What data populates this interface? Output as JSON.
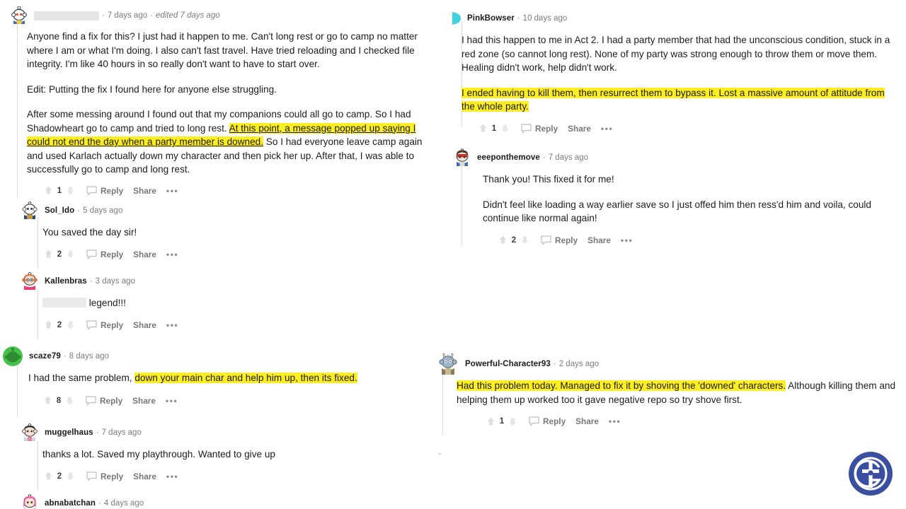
{
  "page": {
    "title": "Reddit comment thread screenshot",
    "watermark_label": "GI logo",
    "watermark_color": "#3b4fa0"
  },
  "highlight_color": "#fcee21",
  "left_column": {
    "comments": [
      {
        "id": "op-comment",
        "username": "",
        "username_redacted": true,
        "timestamp": "7 days ago",
        "edited": "edited 7 days ago",
        "avatar_name": "snoo-avatar-blue",
        "avatar_color": "#4c6ea8",
        "paragraphs": [
          "Anyone find a fix for this? I just had it happen to me. Can't long rest or go to camp no matter where I am or what I'm doing. I also can't fast travel. Have tried reloading and I checked file integrity. I'm like 40 hours in so really don't want to have to start over.",
          "Edit: Putting the fix I found here for anyone else struggling."
        ],
        "body_pre": "After some messing around I found out that my companions could all go to camp. So I had Shadowheart go to camp and tried to long rest. ",
        "body_highlight": "At this point, a message popped up saying I could not end the day when a party member is downed.",
        "body_post": " So I had everyone leave camp again and used Karlach actually down my character and then pick her up. After that, I was able to successfully go to camp and long rest.",
        "score": "1",
        "reply_label": "Reply",
        "share_label": "Share",
        "more_label": "•••"
      },
      {
        "id": "sol-ido-comment",
        "username": "Sol_Ido",
        "username_redacted": false,
        "timestamp": "5 days ago",
        "edited": "",
        "avatar_name": "snoo-avatar-white-blue",
        "avatar_color": "#dfe7ef",
        "body": "You saved the day sir!",
        "score": "2",
        "reply_label": "Reply",
        "share_label": "Share",
        "more_label": "•••"
      },
      {
        "id": "kallenbras-comment",
        "username": "Kallenbras",
        "username_redacted": false,
        "timestamp": "3 days ago",
        "edited": "",
        "avatar_name": "snoo-avatar-orange-glasses",
        "avatar_color": "#e06c3a",
        "body_redacted_prefix": true,
        "body": "legend!!!",
        "score": "2",
        "reply_label": "Reply",
        "share_label": "Share",
        "more_label": "•••"
      },
      {
        "id": "scaze79-comment",
        "username": "scaze79",
        "username_redacted": false,
        "timestamp": "8 days ago",
        "edited": "",
        "avatar_name": "snoo-avatar-green",
        "avatar_color": "#46c14a",
        "body_pre": "I had the same problem, ",
        "body_highlight": "down your main char and help him up, then its fixed.",
        "body_post": "",
        "score": "8",
        "reply_label": "Reply",
        "share_label": "Share",
        "more_label": "•••"
      },
      {
        "id": "muggelhaus-comment",
        "username": "muggelhaus",
        "username_redacted": false,
        "timestamp": "7 days ago",
        "edited": "",
        "avatar_name": "snoo-avatar-pale",
        "avatar_color": "#f0d9cf",
        "body": "thanks a lot. Saved my playthrough. Wanted to give up",
        "score": "2",
        "reply_label": "Reply",
        "share_label": "Share",
        "more_label": "•••"
      },
      {
        "id": "abnabatchan-comment",
        "username": "abnabatchan",
        "username_redacted": false,
        "timestamp": "4 days ago",
        "edited": "",
        "avatar_name": "snoo-avatar-pink-hair",
        "avatar_color": "#f25fa0",
        "body": "",
        "score": "",
        "reply_label": "",
        "share_label": "",
        "more_label": ""
      }
    ]
  },
  "right_column": {
    "comments": [
      {
        "id": "pinkbowser-comment",
        "username": "PinkBowser",
        "username_redacted": false,
        "timestamp": "10 days ago",
        "edited": "",
        "avatar_name": "snoo-avatar-cyan-partial",
        "avatar_color": "#3fd2e0",
        "paragraphs": [
          "I had this happen to me in Act 2. I had a party member that had the unconscious condition, stuck in a red zone (so cannot long rest). None of my party was strong enough to throw them or move them. Healing didn't work, help didn't work."
        ],
        "body_highlight": "I ended having to kill them, then resurrect them to bypass it. Lost a massive amount of attitude from the whole party.",
        "score": "1",
        "reply_label": "Reply",
        "share_label": "Share",
        "more_label": "•••"
      },
      {
        "id": "eeeponthemove-comment",
        "username": "eeeponthemove",
        "username_redacted": false,
        "timestamp": "7 days ago",
        "edited": "",
        "avatar_name": "snoo-avatar-dark-helmet",
        "avatar_color": "#7a4a3a",
        "paragraphs": [
          "Thank you! This fixed it for me!",
          "Didn't feel like loading a way earlier save so I just offed him then ress'd him and voila, could continue like normal again!"
        ],
        "score": "2",
        "reply_label": "Reply",
        "share_label": "Share",
        "more_label": "•••"
      },
      {
        "id": "powerful-character93-comment",
        "username": "Powerful-Character93",
        "username_redacted": false,
        "timestamp": "2 days ago",
        "edited": "",
        "avatar_name": "snoo-avatar-bunny-ears",
        "avatar_color": "#9fb6c9",
        "body_highlight": "Had this problem today. Managed to fix it by shoving the 'downed' characters.",
        "body_post": " Although killing them and helping them up worked too it gave negative repo so try shove first.",
        "score": "1",
        "reply_label": "Reply",
        "share_label": "Share",
        "more_label": "•••"
      }
    ]
  }
}
